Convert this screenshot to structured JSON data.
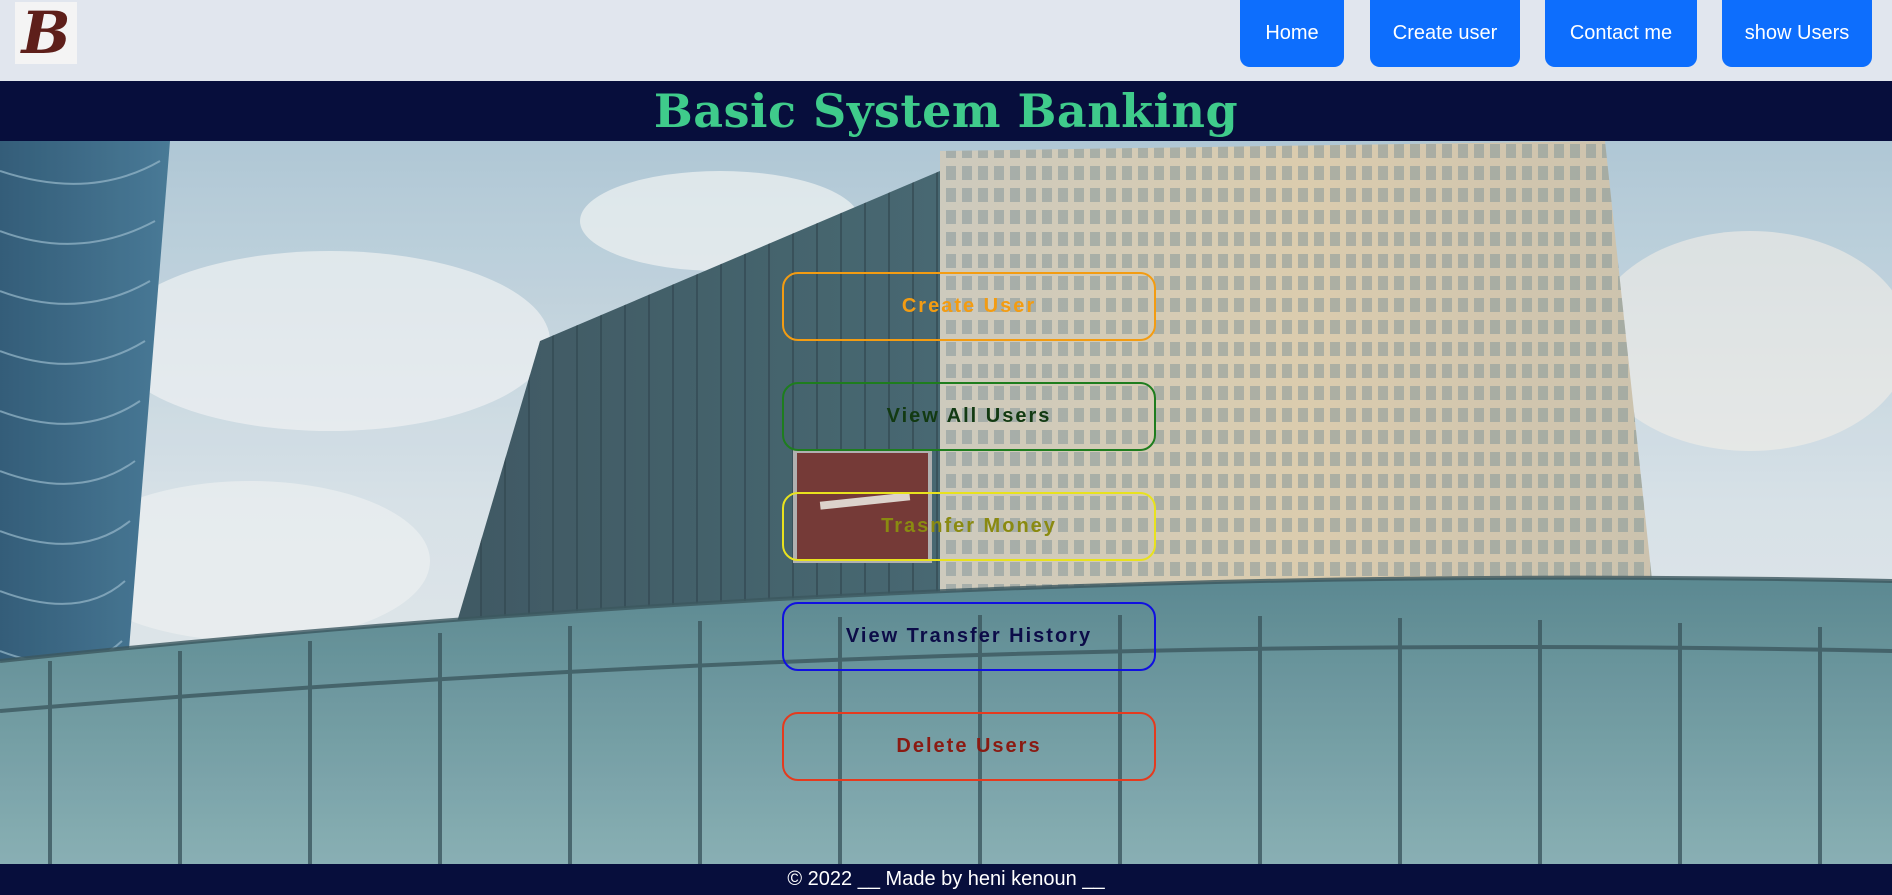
{
  "navbar": {
    "logo_letter": "B",
    "links": [
      {
        "label": "Home"
      },
      {
        "label": "Create user"
      },
      {
        "label": "Contact me"
      },
      {
        "label": "show Users"
      }
    ],
    "link_color": "#0d6efd"
  },
  "banner": {
    "title": "Basic System Banking",
    "background": "#070e3c",
    "title_color": "#3fcb8b"
  },
  "actions": [
    {
      "label": "Create User",
      "color": "#f39c12"
    },
    {
      "label": "View All Users",
      "color": "#1e7d1e"
    },
    {
      "label": "Trasnfer Money",
      "color": "#e8e21e"
    },
    {
      "label": "View Transfer History",
      "color": "#1010e0"
    },
    {
      "label": "Delete Users",
      "color": "#e53a1e"
    }
  ],
  "footer": {
    "text": "© 2022 __ Made by heni kenoun __"
  }
}
